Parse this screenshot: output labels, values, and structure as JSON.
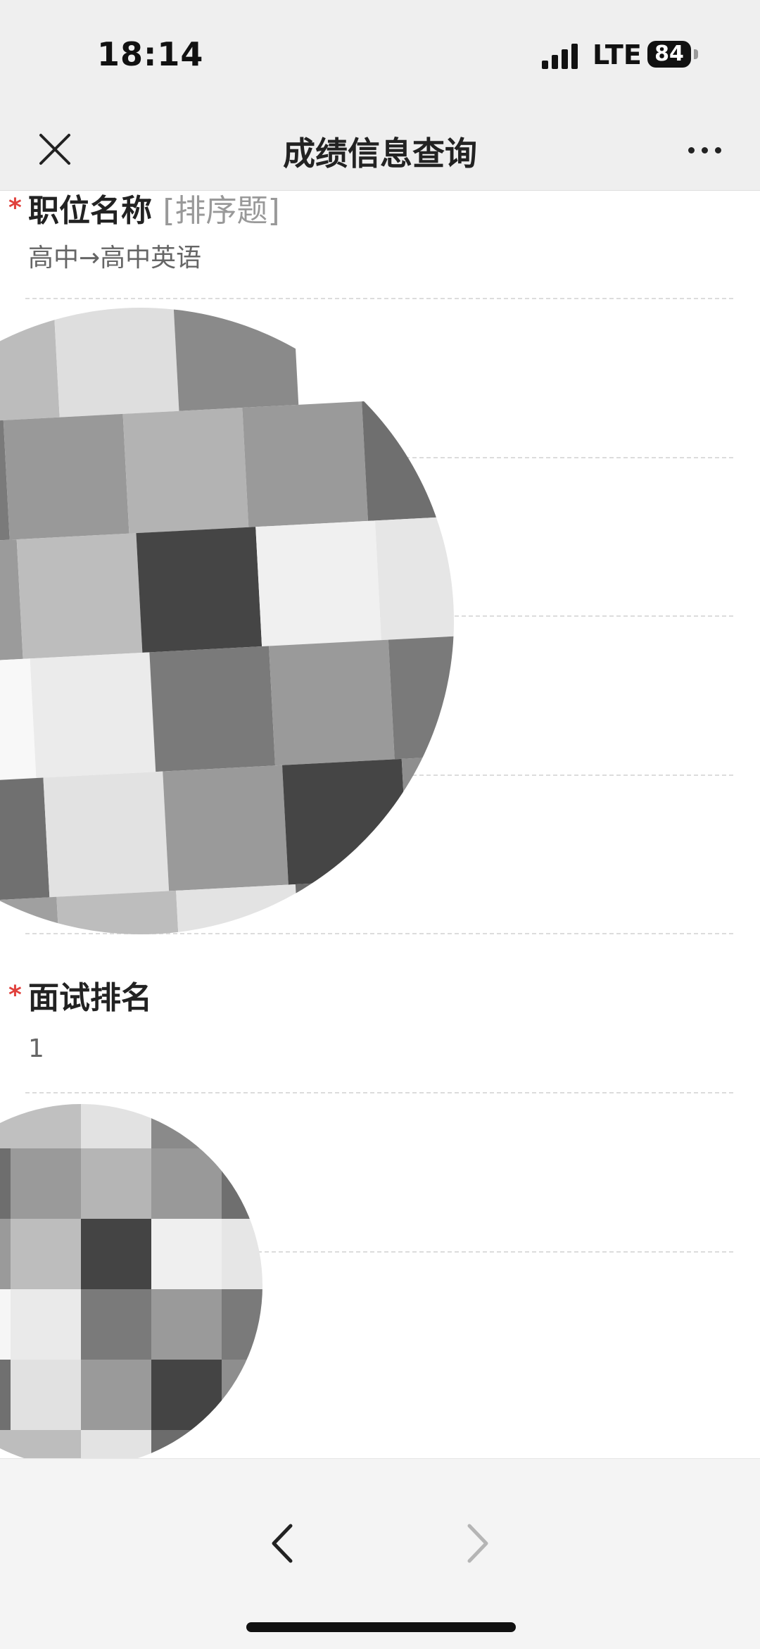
{
  "status_bar": {
    "time": "18:14",
    "network": "LTE",
    "battery": "84"
  },
  "nav_bar": {
    "title": "成绩信息查询",
    "close_icon": "close-icon",
    "more_icon": "more-icon"
  },
  "fields": [
    {
      "required_mark": "*",
      "label": "职位名称",
      "hint": "[排序题]",
      "value": "高中→高中英语"
    },
    {
      "required_mark": "*",
      "label": "面试排名",
      "hint": "",
      "value": "1"
    }
  ],
  "bottom_bar": {
    "back_icon": "chevron-left-icon",
    "forward_icon": "chevron-right-icon"
  },
  "colors": {
    "required": "#e0403c",
    "background": "#ffffff",
    "chrome": "#efefef"
  }
}
